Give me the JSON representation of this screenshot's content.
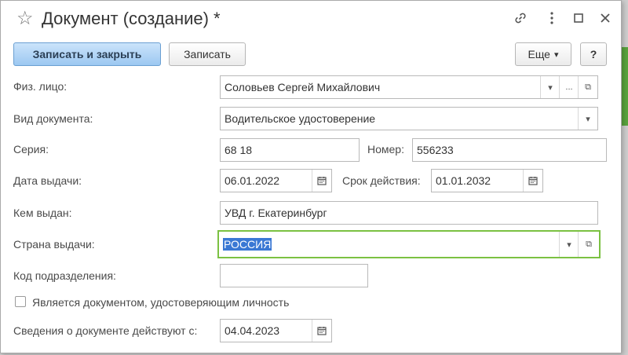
{
  "window": {
    "title": "Документ (создание) *"
  },
  "toolbar": {
    "save_close": "Записать и закрыть",
    "save": "Записать",
    "more": "Еще",
    "more_arrow": "▾",
    "help": "?"
  },
  "form": {
    "person": {
      "label": "Физ. лицо:",
      "value": "Соловьев Сергей Михайлович"
    },
    "doc_type": {
      "label": "Вид документа:",
      "value": "Водительское удостоверение"
    },
    "series": {
      "label": "Серия:",
      "value": "68 18"
    },
    "number": {
      "label": "Номер:",
      "value": "556233"
    },
    "issue_date": {
      "label": "Дата выдачи:",
      "value": "06.01.2022"
    },
    "valid_until": {
      "label": "Срок действия:",
      "value": "01.01.2032"
    },
    "issued_by": {
      "label": "Кем выдан:",
      "value": "УВД г. Екатеринбург"
    },
    "country": {
      "label": "Страна выдачи:",
      "value": "РОССИЯ"
    },
    "dept_code": {
      "label": "Код подразделения:",
      "value": ""
    },
    "is_identity": {
      "label": "Является документом, удостоверяющим личность",
      "checked": false
    },
    "effective_from": {
      "label": "Сведения о документе действуют с:",
      "value": "04.04.2023"
    }
  },
  "glyphs": {
    "dropdown": "▾",
    "ellipsis": "...",
    "open": "⧉"
  },
  "colors": {
    "primary_button": "#9cc8f1",
    "focus_border": "#7bc142",
    "selection": "#3a78d4"
  },
  "icons": [
    "star-icon",
    "link-icon",
    "more-vertical-icon",
    "maximize-icon",
    "close-icon",
    "calendar-icon",
    "open-form-icon",
    "dropdown-arrow-icon"
  ]
}
